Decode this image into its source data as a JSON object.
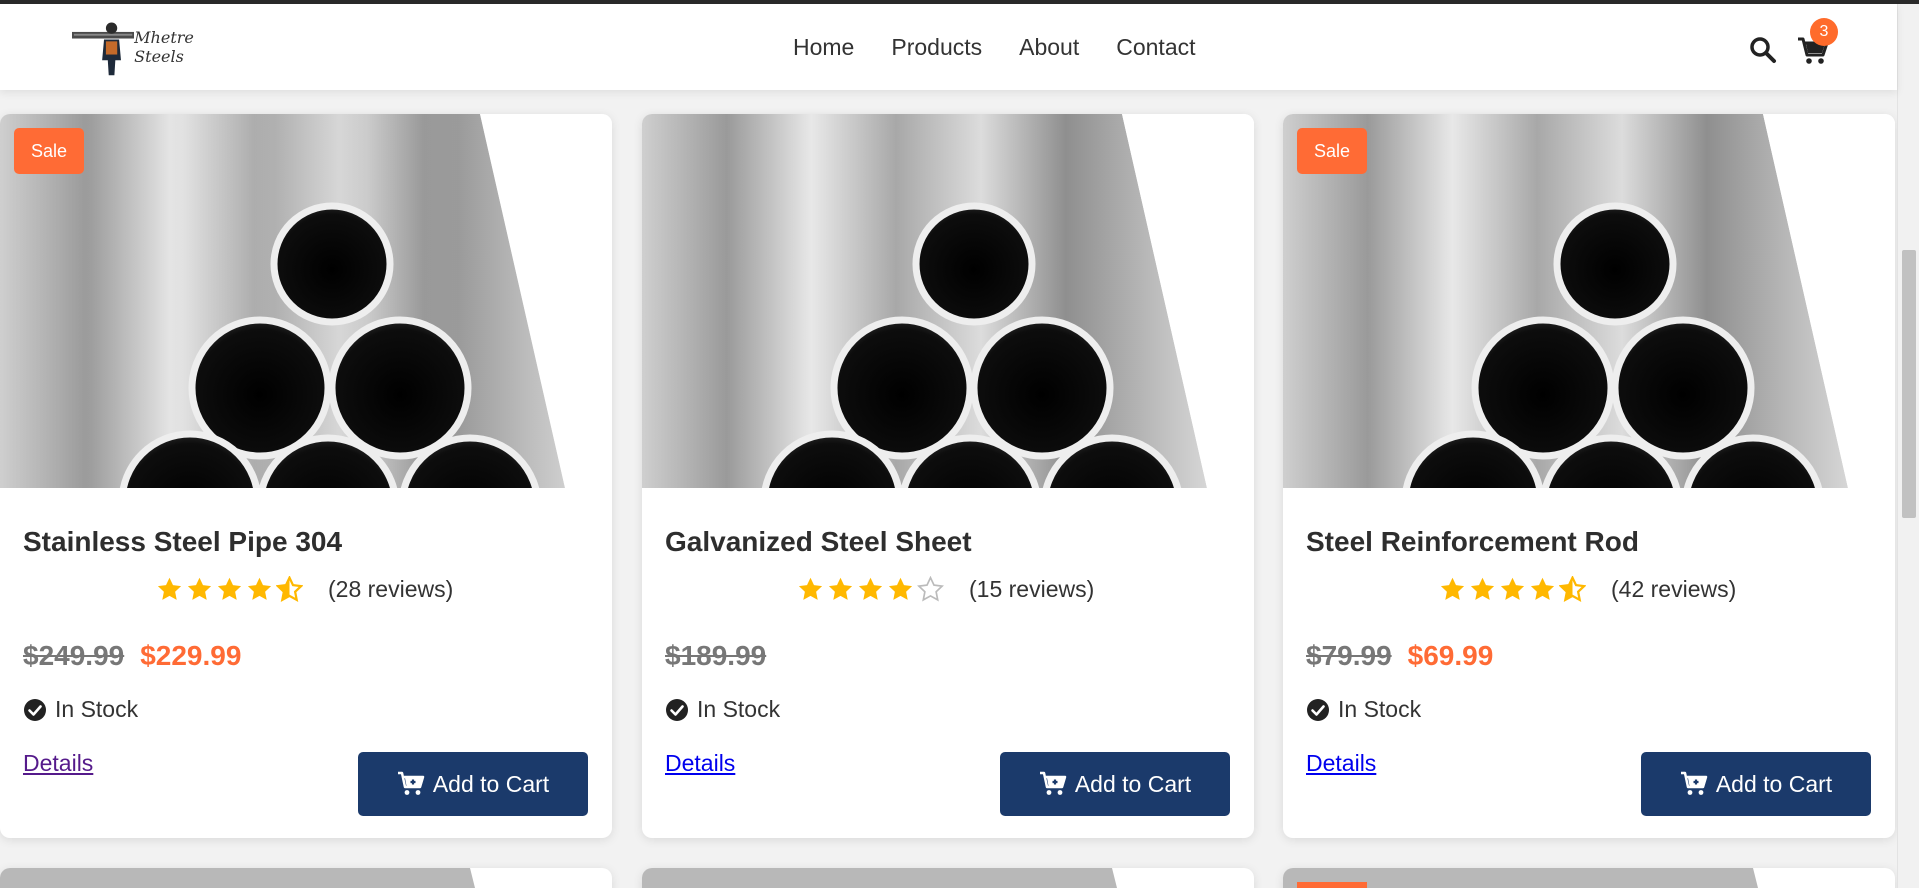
{
  "header": {
    "logo_text": "Mhetre Steels",
    "nav": [
      "Home",
      "Products",
      "About",
      "Contact"
    ],
    "cart_count": "3"
  },
  "icons": {
    "search": "search-icon",
    "cart": "cart-icon",
    "star": "star-icon",
    "check": "check-circle-icon",
    "cart_plus": "cart-plus-icon"
  },
  "colors": {
    "accent": "#ff6b35",
    "button": "#1b3a6b",
    "star": "#ffb800",
    "link": "#0000ee"
  },
  "products": [
    {
      "badge": "Sale",
      "title": "Stainless Steel Pipe 304",
      "rating": 4.5,
      "reviews": "(28 reviews)",
      "old_price": "$249.99",
      "new_price": "$229.99",
      "stock": "In Stock",
      "details": "Details",
      "button": "Add to Cart"
    },
    {
      "badge": "",
      "title": "Galvanized Steel Sheet",
      "rating": 4,
      "reviews": "(15 reviews)",
      "old_price": "$189.99",
      "new_price": "",
      "stock": "In Stock",
      "details": "Details",
      "button": "Add to Cart"
    },
    {
      "badge": "Sale",
      "title": "Steel Reinforcement Rod",
      "rating": 4.5,
      "reviews": "(42 reviews)",
      "old_price": "$79.99",
      "new_price": "$69.99",
      "stock": "In Stock",
      "details": "Details",
      "button": "Add to Cart"
    }
  ]
}
